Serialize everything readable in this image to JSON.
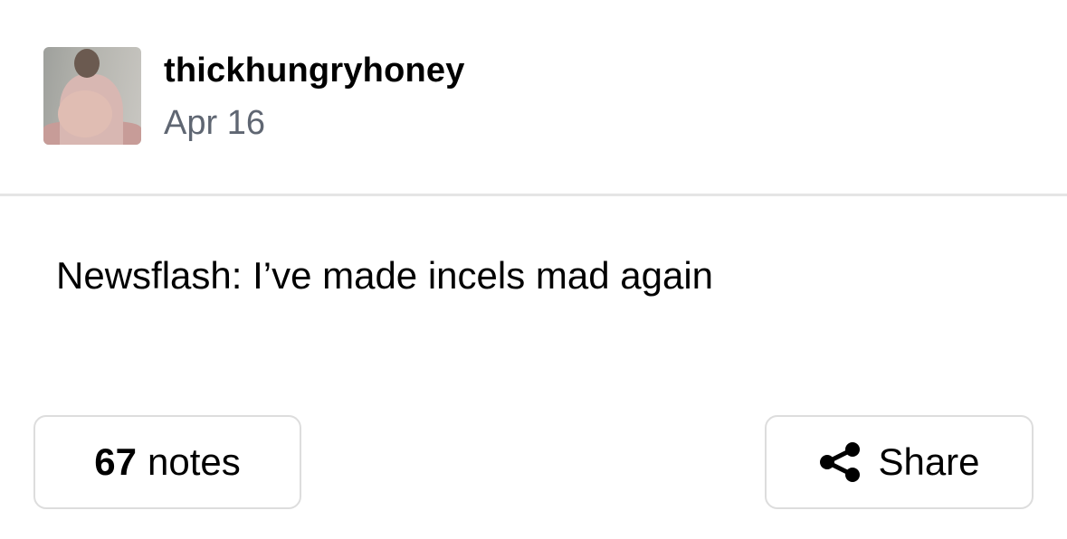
{
  "post": {
    "username": "thickhungryhoney",
    "date": "Apr 16",
    "text": "Newsflash: I’ve made incels mad again"
  },
  "footer": {
    "notes_count": "67",
    "notes_label": "notes",
    "share_label": "Share",
    "share_icon": "share-icon"
  }
}
